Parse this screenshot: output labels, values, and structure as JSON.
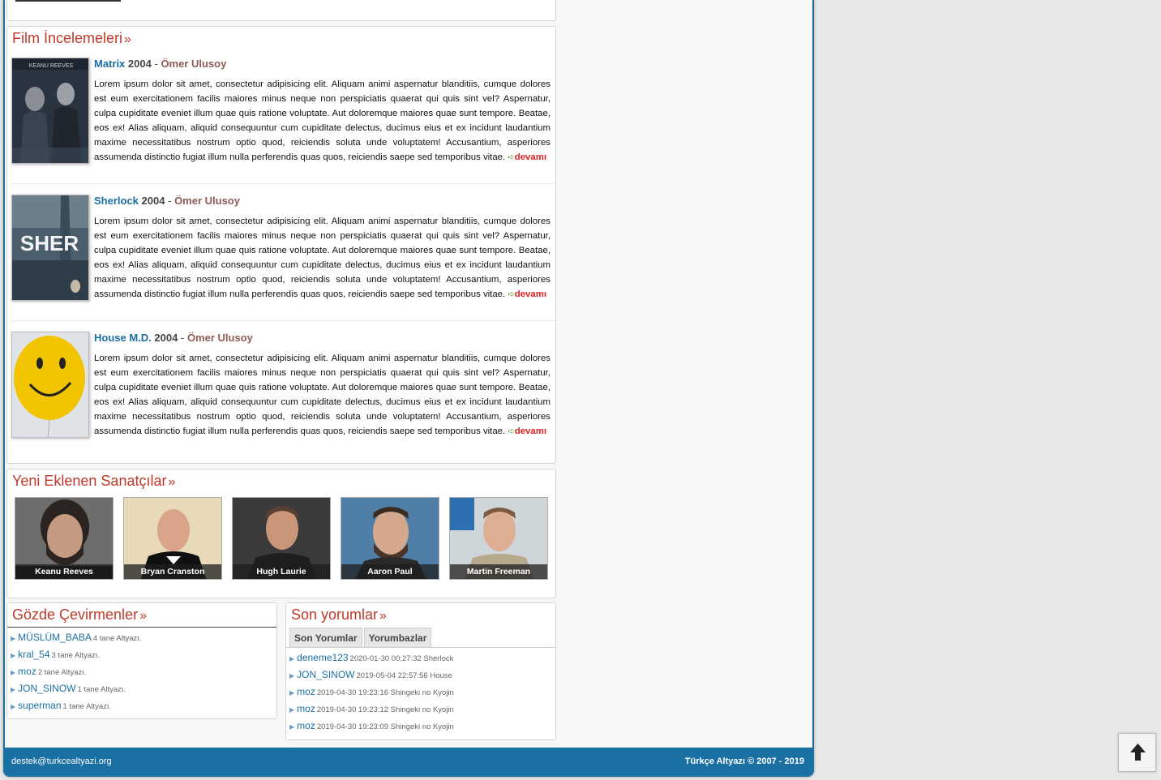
{
  "reviews_section": {
    "title": "Film İncelemeleri",
    "arrow": "»",
    "items": [
      {
        "title": "Matrix",
        "year": "2004",
        "author": "Ömer Ulusoy",
        "text": "Lorem ipsum dolor sit amet, consectetur adipisicing elit. Aliquam animi aspernatur blanditiis, cumque dolores est eum exercitationem facilis maiores minus neque non perspiciatis quaerat qui quis sint vel? Aspernatur, culpa cupiditate eveniet illum quae quis ratione voluptate. Aut doloremque maiores quae sunt tempore. Beatae, eos ex! Alias aliquam, aliquid consequuntur cum cupiditate delectus, ducimus eius et ex incidunt laudantium maxime necessitatibus nostrum optio quod, reiciendis soluta unde voluptatem! Accusantium, asperiores assumenda distinctio fugiat illum nulla perferendis quas quos, reiciendis saepe sed temporibus vitae.",
        "more": "devamı"
      },
      {
        "title": "Sherlock",
        "year": "2004",
        "author": "Ömer Ulusoy",
        "text": "Lorem ipsum dolor sit amet, consectetur adipisicing elit. Aliquam animi aspernatur blanditiis, cumque dolores est eum exercitationem facilis maiores minus neque non perspiciatis quaerat qui quis sint vel? Aspernatur, culpa cupiditate eveniet illum quae quis ratione voluptate. Aut doloremque maiores quae sunt tempore. Beatae, eos ex! Alias aliquam, aliquid consequuntur cum cupiditate delectus, ducimus eius et ex incidunt laudantium maxime necessitatibus nostrum optio quod, reiciendis soluta unde voluptatem! Accusantium, asperiores assumenda distinctio fugiat illum nulla perferendis quas quos, reiciendis saepe sed temporibus vitae.",
        "more": "devamı",
        "poster_text": "SHER"
      },
      {
        "title": "House M.D.",
        "year": "2004",
        "author": "Ömer Ulusoy",
        "text": "Lorem ipsum dolor sit amet, consectetur adipisicing elit. Aliquam animi aspernatur blanditiis, cumque dolores est eum exercitationem facilis maiores minus neque non perspiciatis quaerat qui quis sint vel? Aspernatur, culpa cupiditate eveniet illum quae quis ratione voluptate. Aut doloremque maiores quae sunt tempore. Beatae, eos ex! Alias aliquam, aliquid consequuntur cum cupiditate delectus, ducimus eius et ex incidunt laudantium maxime necessitatibus nostrum optio quod, reiciendis soluta unde voluptatem! Accusantium, asperiores assumenda distinctio fugiat illum nulla perferendis quas quos, reiciendis saepe sed temporibus vitae.",
        "more": "devamı"
      }
    ]
  },
  "artists_section": {
    "title": "Yeni Eklenen Sanatçılar",
    "arrow": "»",
    "artists": [
      "Keanu Reeves",
      "Bryan Cranston",
      "Hugh Laurie",
      "Aaron Paul",
      "Martin Freeman"
    ]
  },
  "translators_section": {
    "title": "Gözde Çevirmenler",
    "arrow": "»",
    "items": [
      {
        "name": "MÜSLÜM_BABA",
        "meta": "4 tane Altyazı."
      },
      {
        "name": "kral_54",
        "meta": "3 tane Altyazı."
      },
      {
        "name": "moz",
        "meta": "2 tane Altyazı."
      },
      {
        "name": "JON_SINOW",
        "meta": "1 tane Altyazı."
      },
      {
        "name": "superman",
        "meta": "1 tane Altyazı."
      }
    ]
  },
  "comments_section": {
    "title": "Son yorumlar",
    "arrow": "»",
    "tabs": [
      "Son Yorumlar",
      "Yorumbazlar"
    ],
    "items": [
      {
        "name": "deneme123",
        "meta": "2020-01-30 00:27:32 Sherlock"
      },
      {
        "name": "JON_SINOW",
        "meta": "2019-05-04 22:57:56 House"
      },
      {
        "name": "moz",
        "meta": "2019-04-30 19:23:16 Shingeki no Kyojin"
      },
      {
        "name": "moz",
        "meta": "2019-04-30 19:23:12 Shingeki no Kyojin"
      },
      {
        "name": "moz",
        "meta": "2019-04-30 19:23:09 Shingeki no Kyojin"
      }
    ]
  },
  "footer": {
    "email": "destek@turkcealtyazi.org",
    "copyright": "Türkçe Altyazı © 2007 - 2019"
  },
  "icons": {
    "more": "arrow-right-icon",
    "bullet": "triangle-right-icon",
    "scroll_top": "arrow-up-icon"
  }
}
